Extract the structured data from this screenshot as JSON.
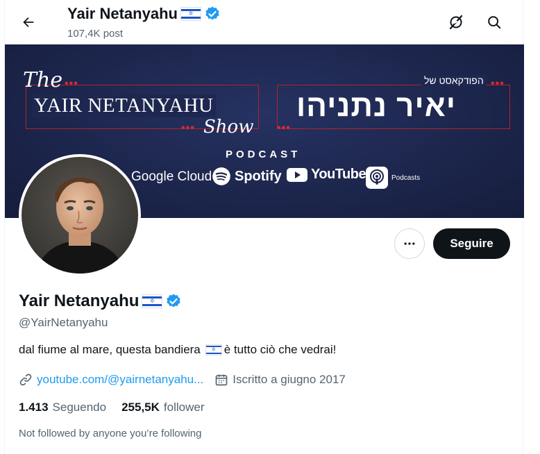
{
  "header": {
    "name": "Yair Netanyahu",
    "post_count": "107,4K post"
  },
  "banner": {
    "the": "The",
    "show_title": "YAIR NETANYAHU",
    "show": "Show",
    "hebrew_small": "הפודקאסט של",
    "hebrew_big": "יאיר נתניהו",
    "podcast": "PODCAST",
    "platforms": {
      "google": "Google Cloud",
      "spotify": "Spotify",
      "youtube": "YouTube",
      "podcasts": "Podcasts"
    }
  },
  "actions": {
    "follow_label": "Seguire"
  },
  "profile": {
    "name": "Yair Netanyahu",
    "handle": "@YairNetanyahu",
    "bio_before": "dal fiume al mare, questa bandiera",
    "bio_after": "è tutto ciò che vedrai!",
    "link": "youtube.com/@yairnetanyahu...",
    "joined": "Iscritto a giugno 2017",
    "following_count": "1.413",
    "following_label": "Seguendo",
    "followers_count": "255,5K",
    "followers_label": "follower",
    "mutual_note": "Not followed by anyone you’re following"
  },
  "colors": {
    "accent": "#1d9bf0",
    "banner_bg": "#1b2449",
    "banner_red": "#b5212f",
    "text_secondary": "#536471",
    "button_dark": "#0f1419"
  },
  "icons": {
    "back": "arrow-left-icon",
    "grok": "grok-icon",
    "search": "search-icon",
    "verified": "verified-badge-icon",
    "flag": "israel-flag-icon",
    "link": "link-icon",
    "calendar": "calendar-icon",
    "more": "more-icon"
  }
}
